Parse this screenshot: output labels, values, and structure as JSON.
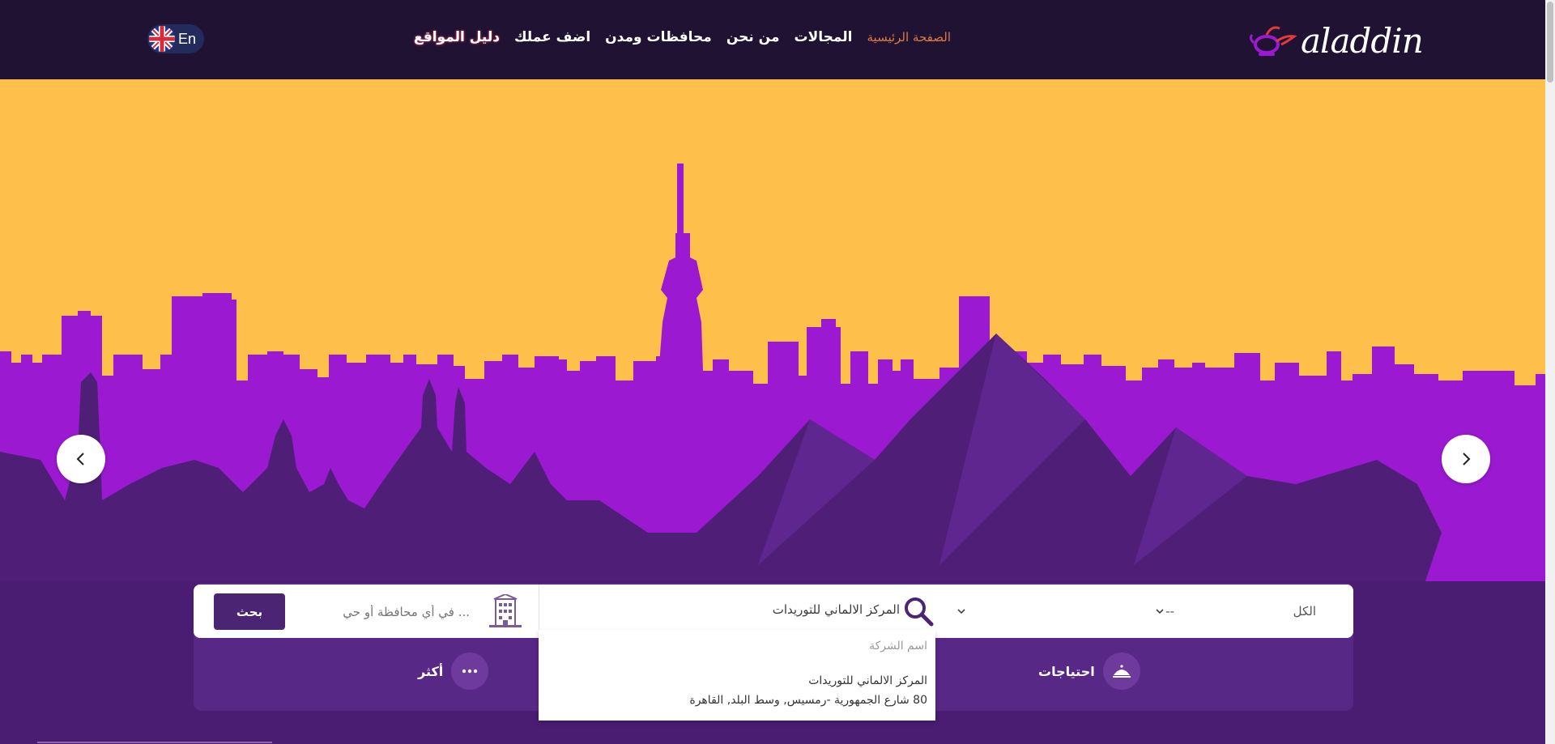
{
  "header": {
    "logo_text": "aladdin",
    "nav": {
      "home": "الصفحة الرئيسية",
      "fields": "المجالات",
      "about": "من نحن",
      "governorates": "محافظات ومدن",
      "add_business": "اضف عملك",
      "sites_guide": "دليل المواقع"
    },
    "language": "En"
  },
  "colors": {
    "header_bg": "#1f1233",
    "sky": "#fec04b",
    "city": "#9b1ad1",
    "monuments": "#4f1f78",
    "accent_orange": "#e07a3f",
    "button": "#4b2474"
  },
  "search": {
    "button_label": "بحث",
    "location_placeholder": "... في أي محافظة أو حي",
    "company_value": "المركز الالماني للتوريدات",
    "select_type": "--",
    "select_scope": "الكل"
  },
  "categories": {
    "needs": "احتياجات",
    "more": "أكثر"
  },
  "dropdown": {
    "header": "اسم الشركة",
    "items": [
      {
        "name": "المركز الالماني للتوريدات",
        "address": "80 شارع الجمهورية -رمسيس, وسط البلد, القاهرة"
      }
    ]
  },
  "icons": {
    "prev": "chevron-left-icon",
    "next": "chevron-right-icon",
    "search": "search-icon",
    "building": "building-icon",
    "needs": "food-tray-icon",
    "more": "dots-icon"
  }
}
